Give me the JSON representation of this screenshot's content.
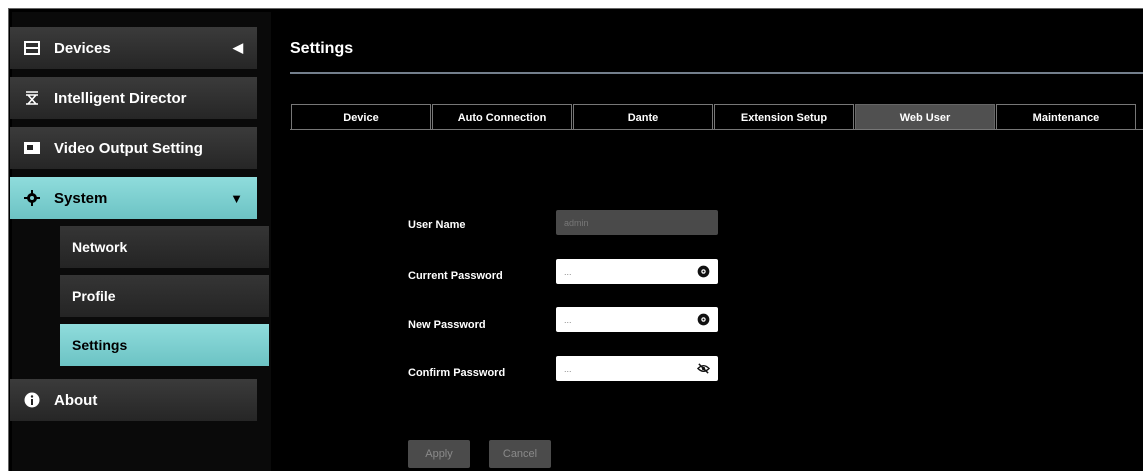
{
  "sidebar": {
    "devices": {
      "label": "Devices",
      "icon": "devices-icon",
      "caret": "◀"
    },
    "intelligent_director": {
      "label": "Intelligent Director",
      "icon": "director-icon"
    },
    "video_output": {
      "label": "Video Output Setting",
      "icon": "monitor-icon"
    },
    "system": {
      "label": "System",
      "icon": "gear-icon",
      "caret": "▼"
    },
    "network": {
      "label": "Network"
    },
    "profile": {
      "label": "Profile"
    },
    "settings": {
      "label": "Settings"
    },
    "about": {
      "label": "About",
      "icon": "info-icon"
    }
  },
  "header": {
    "title": "Settings"
  },
  "tabs": [
    {
      "label": "Device"
    },
    {
      "label": "Auto Connection"
    },
    {
      "label": "Dante"
    },
    {
      "label": "Extension Setup"
    },
    {
      "label": "Web User",
      "active": true
    },
    {
      "label": "Maintenance"
    }
  ],
  "form": {
    "user_name": {
      "label": "User Name",
      "value": "admin"
    },
    "current_password": {
      "label": "Current Password",
      "value": "..."
    },
    "new_password": {
      "label": "New Password",
      "value": "..."
    },
    "confirm_password": {
      "label": "Confirm Password",
      "value": "..."
    }
  },
  "buttons": {
    "apply": "Apply",
    "cancel": "Cancel"
  },
  "colors": {
    "accent": "#7ccfd0",
    "background": "#000000",
    "nav_bg": "#2e2e2e"
  }
}
